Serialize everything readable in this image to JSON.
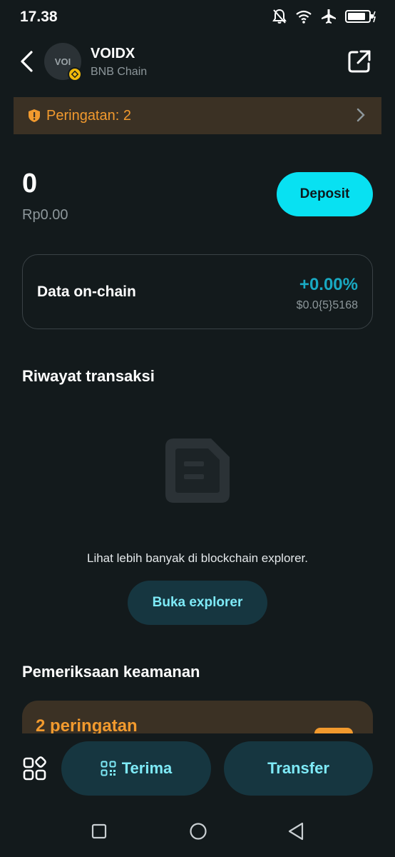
{
  "status_bar": {
    "time": "17.38"
  },
  "header": {
    "avatar_text": "VOI",
    "token_name": "VOIDX",
    "chain_name": "BNB Chain"
  },
  "warning": {
    "text": "Peringatan: 2"
  },
  "balance": {
    "amount": "0",
    "fiat": "Rp0.00",
    "deposit_label": "Deposit"
  },
  "onchain": {
    "title": "Data on-chain",
    "change": "+0.00%",
    "price": "$0.0{5}5168"
  },
  "history": {
    "title": "Riwayat transaksi",
    "empty_text": "Lihat lebih banyak di blockchain explorer.",
    "explorer_label": "Buka explorer"
  },
  "security": {
    "title": "Pemeriksaan keamanan",
    "warning_count_text": "2 peringatan"
  },
  "actions": {
    "receive_label": "Terima",
    "transfer_label": "Transfer"
  },
  "colors": {
    "background": "#131a1c",
    "accent_cyan": "#08e1f2",
    "warning_orange": "#f29a2e",
    "change_teal": "#19a9c2"
  }
}
